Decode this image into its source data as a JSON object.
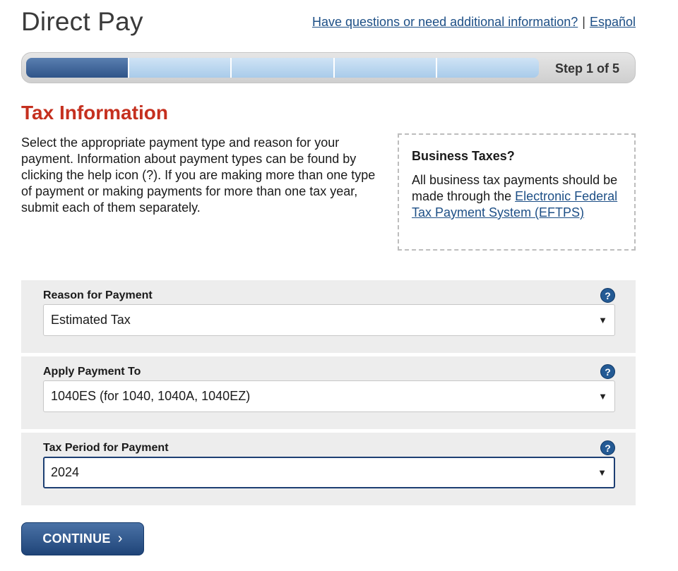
{
  "header": {
    "title": "Direct Pay",
    "help_link": "Have questions or need additional information?",
    "separator": "|",
    "lang_link": "Español"
  },
  "progress": {
    "current_step": 1,
    "total_steps": 5,
    "label": "Step 1 of 5"
  },
  "section": {
    "title": "Tax Information",
    "intro": "Select the appropriate payment type and reason for your payment. Information about payment types can be found by clicking the help icon (?). If you are making more than one type of payment or making payments for more than one tax year, submit each of them separately."
  },
  "business_box": {
    "title": "Business Taxes?",
    "text_before": "All business tax payments should be made through the ",
    "link": "Electronic Federal Tax Payment System (EFTPS)"
  },
  "fields": {
    "reason": {
      "label": "Reason for Payment",
      "value": "Estimated Tax",
      "help": "?",
      "caret": "▼"
    },
    "apply_to": {
      "label": "Apply Payment To",
      "value": "1040ES (for 1040, 1040A, 1040EZ)",
      "help": "?",
      "caret": "▼"
    },
    "tax_period": {
      "label": "Tax Period for Payment",
      "value": "2024",
      "help": "?",
      "caret": "▼"
    }
  },
  "actions": {
    "continue_label": "CONTINUE",
    "continue_icon": "chevron-right-icon",
    "continue_glyph": "›"
  },
  "colors": {
    "accent_red": "#c5301f",
    "link_blue": "#1d4f86",
    "button_blue": "#1f4478"
  }
}
